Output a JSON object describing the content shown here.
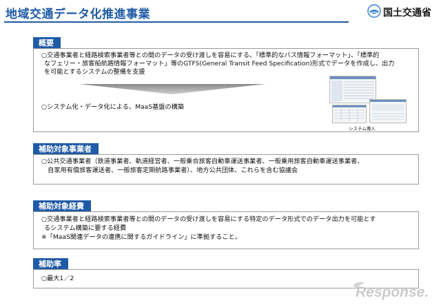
{
  "header": {
    "title": "地域交通データ化推進事業",
    "org": "国土交通省"
  },
  "sections": [
    {
      "heading": "概要",
      "paragraphs": [
        "○交通事業者と経路検索事業者等との間のデータの受け渡しを容易にする、「標準的なバス情報フォーマット」、「標準的",
        "なフェリー・旅客船航路情報フォーマット」等のGTFS(General Transit Feed Specification)形式でデータを作成し、出力",
        "を可能とするシステムの整備を支援",
        "○システム化・データ化による、MaaS基盤の構築"
      ],
      "image_caption": "システム導入"
    },
    {
      "heading": "補助対象事業者",
      "paragraphs": [
        "○公共交通事業者（鉄道事業者、軌道経営者、一般乗合旅客自動車運送事業者、一般乗用旅客自動車運送事業者、",
        "　自家用有償旅客運送者、一般旅客定期航路事業者）、地方公共団体、これらを含む協議会"
      ]
    },
    {
      "heading": "補助対象経費",
      "paragraphs": [
        "○交通事業者と経路検索事業者等との間のデータの受け渡しを容易にする特定のデータ形式でのデータ出力を可能とす",
        "るシステム構築に要する経費",
        "※「MaaS関連データの連携に関するガイドライン」に準拠すること。"
      ]
    },
    {
      "heading": "補助率",
      "paragraphs": [
        "○最大1／2"
      ]
    }
  ],
  "watermark": "Response.",
  "colors": {
    "brand_blue": "#1f5aa6",
    "box_border": "#9a9a9a"
  }
}
